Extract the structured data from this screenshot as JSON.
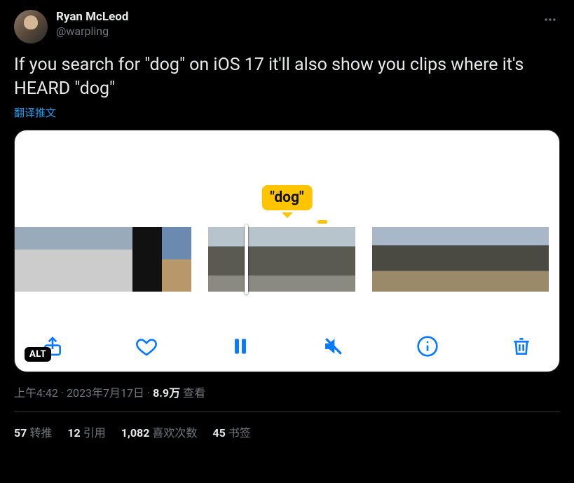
{
  "author": {
    "display_name": "Ryan McLeod",
    "handle": "@warpling"
  },
  "tweet_text": "If you search for \"dog\" on iOS 17 it'll also show you clips where it's HEARD \"dog\"",
  "translate_label": "翻译推文",
  "media": {
    "bubble": "\"dog\"",
    "alt": "ALT"
  },
  "meta": {
    "time": "上午4:42",
    "sep1": " · ",
    "date": "2023年7月17日",
    "sep2": " · ",
    "views_num": "8.9万",
    "views_label": " 查看"
  },
  "stats": {
    "retweets": {
      "num": "57",
      "label": "转推"
    },
    "quotes": {
      "num": "12",
      "label": "引用"
    },
    "likes": {
      "num": "1,082",
      "label": "喜欢次数"
    },
    "bookmarks": {
      "num": "45",
      "label": "书签"
    }
  }
}
